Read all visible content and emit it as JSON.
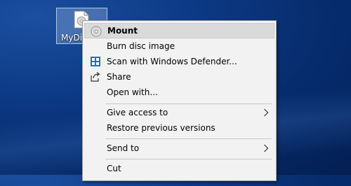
{
  "desktop": {
    "file_icon_label": "MyDi"
  },
  "context_menu": {
    "items": [
      {
        "label": "Mount",
        "icon": "disc-icon"
      },
      {
        "label": "Burn disc image"
      },
      {
        "label": "Scan with Windows Defender...",
        "icon": "defender-icon"
      },
      {
        "label": "Share",
        "icon": "share-icon"
      },
      {
        "label": "Open with..."
      },
      {
        "label": "Give access to",
        "submenu": true
      },
      {
        "label": "Restore previous versions"
      },
      {
        "label": "Send to",
        "submenu": true
      },
      {
        "label": "Cut"
      }
    ]
  }
}
